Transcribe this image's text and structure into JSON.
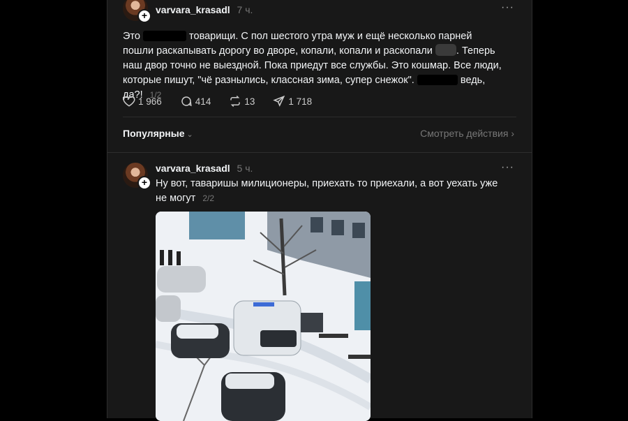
{
  "post1": {
    "username": "varvara_krasadl",
    "time": "7 ч.",
    "more": "···",
    "text_a": "Это",
    "text_b": "товарищи. С пол шестого утра муж и ещё несколько парней пошли раскапывать дорогу во дворе, копали, копали и раскопали",
    "text_c": ". Теперь наш двор точно не выездной. Пока приедут все службы. Это кошмар. Все люди, которые пишут, \"чё разнылись, классная зима, супер снежок\".",
    "text_d": "ведь, да?!",
    "counter": "1/2",
    "likes": "1 966",
    "comments": "414",
    "reposts": "13",
    "shares": "1 718"
  },
  "sortbar": {
    "sort_label": "Популярные",
    "activity_label": "Смотреть действия"
  },
  "post2": {
    "username": "varvara_krasadl",
    "time": "5 ч.",
    "more": "···",
    "text": "Ну вот, таваришы милиционеры, приехать то приехали, а вот уехать уже не могут",
    "counter": "2/2"
  }
}
